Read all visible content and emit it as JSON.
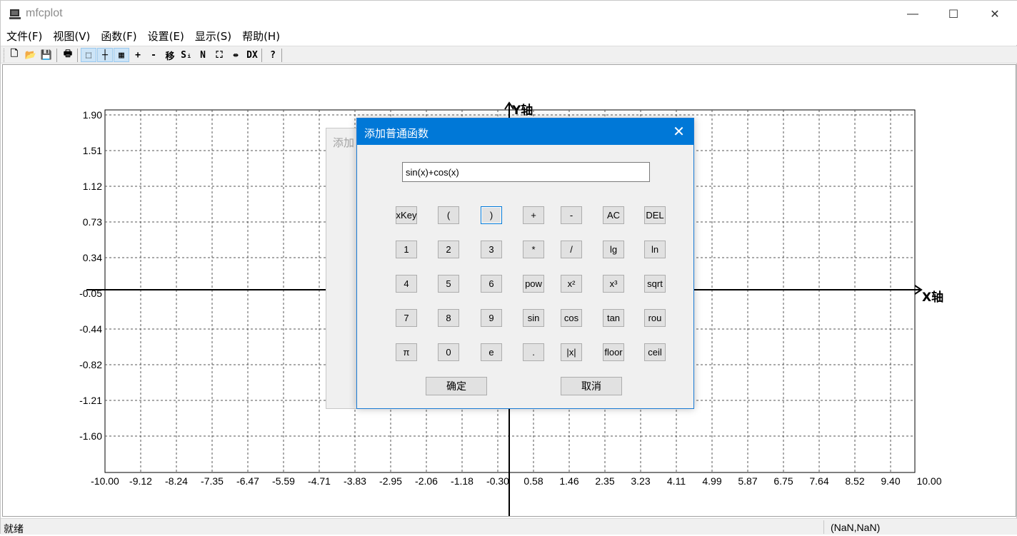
{
  "window": {
    "title": "mfcplot",
    "controls": {
      "minimize": "—",
      "maximize": "☐",
      "close": "✕"
    }
  },
  "menubar": [
    {
      "label": "文件(F)"
    },
    {
      "label": "视图(V)"
    },
    {
      "label": "函数(F)"
    },
    {
      "label": "设置(E)"
    },
    {
      "label": "显示(S)"
    },
    {
      "label": "帮助(H)"
    }
  ],
  "toolbar": {
    "buttons": [
      {
        "name": "new-icon",
        "glyph": "🗋"
      },
      {
        "name": "open-icon",
        "glyph": "📂"
      },
      {
        "name": "save-icon",
        "glyph": "💾"
      },
      {
        "name": "print-icon",
        "glyph": "🖶"
      },
      {
        "name": "select-tool-icon",
        "glyph": "⬚",
        "active": true
      },
      {
        "name": "crosshair-tool-icon",
        "glyph": "┼",
        "active": true
      },
      {
        "name": "grid-toggle-icon",
        "glyph": "▦",
        "active": true
      },
      {
        "name": "zoom-in-icon",
        "glyph": "+"
      },
      {
        "name": "zoom-out-icon",
        "glyph": "-"
      },
      {
        "name": "move-icon",
        "glyph": "移"
      },
      {
        "name": "si-icon",
        "glyph": "Sᵢ"
      },
      {
        "name": "n-icon",
        "glyph": "N"
      },
      {
        "name": "fit-icon",
        "glyph": "⛶"
      },
      {
        "name": "split-icon",
        "glyph": "⇹"
      },
      {
        "name": "dx-icon",
        "glyph": "DX"
      },
      {
        "name": "help-icon",
        "glyph": "?"
      }
    ]
  },
  "plot": {
    "x_axis_label": "X轴",
    "y_axis_label": "Y轴",
    "x_ticks": [
      "-10.00",
      "-9.12",
      "-8.24",
      "-7.35",
      "-6.47",
      "-5.59",
      "-4.71",
      "-3.83",
      "-2.95",
      "-2.06",
      "-1.18",
      "-0.30",
      "0.58",
      "1.46",
      "2.35",
      "3.23",
      "4.11",
      "4.99",
      "5.87",
      "6.75",
      "7.64",
      "8.52",
      "9.40",
      "10.00"
    ],
    "y_ticks": [
      "1.90",
      "1.51",
      "1.12",
      "0.73",
      "0.34",
      "-0.05",
      "-0.44",
      "-0.82",
      "-1.21",
      "-1.60"
    ],
    "grid": true
  },
  "background_dialog": {
    "title": "添加"
  },
  "dialog": {
    "title": "添加普通函数",
    "close_glyph": "✕",
    "expression": "sin(x)+cos(x)",
    "keys": [
      [
        "xKey",
        "(",
        ")",
        "+",
        "-",
        "AC",
        "DEL"
      ],
      [
        "1",
        "2",
        "3",
        "*",
        "/",
        "lg",
        "ln"
      ],
      [
        "4",
        "5",
        "6",
        "pow",
        "x²",
        "x³",
        "sqrt"
      ],
      [
        "7",
        "8",
        "9",
        "sin",
        "cos",
        "tan",
        "rou"
      ],
      [
        "π",
        "0",
        "e",
        ".",
        "|x|",
        "floor",
        "ceil"
      ]
    ],
    "ok_label": "确定",
    "cancel_label": "取消"
  },
  "statusbar": {
    "status": "就绪",
    "coords": "(NaN,NaN)"
  }
}
